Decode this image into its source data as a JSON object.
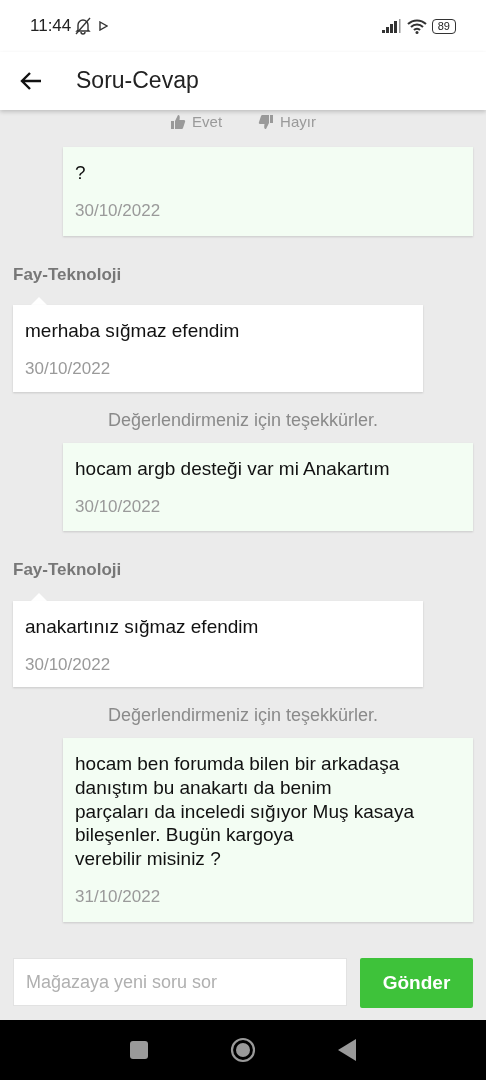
{
  "status_bar": {
    "time": "11:44",
    "battery": "89"
  },
  "app_bar": {
    "title": "Soru-Cevap"
  },
  "thread": [
    {
      "kind": "rating",
      "yes": "Evet",
      "no": "Hayır"
    },
    {
      "kind": "question",
      "text": "?",
      "date": "30/10/2022"
    },
    {
      "kind": "answer",
      "sender": "Fay-Teknoloji",
      "text": "merhaba sığmaz efendim",
      "date": "30/10/2022"
    },
    {
      "kind": "note",
      "text": "Değerlendirmeniz için teşekkürler."
    },
    {
      "kind": "question",
      "text": "hocam argb desteği var mi Anakartım",
      "date": "30/10/2022"
    },
    {
      "kind": "answer",
      "sender": "Fay-Teknoloji",
      "text": "anakartınız sığmaz efendim",
      "date": "30/10/2022"
    },
    {
      "kind": "note",
      "text": "Değerlendirmeniz için teşekkürler."
    },
    {
      "kind": "question",
      "text": "hocam ben forumda bilen bir arkadaşa\ndanıştım bu anakartı da benim\nparçaları da inceledi sığıyor Muş kasaya\nbileşenler. Bugün kargoya\nverebilir misiniz ?",
      "date": "31/10/2022"
    }
  ],
  "composer": {
    "placeholder": "Mağazaya yeni soru sor",
    "button": "Gönder"
  }
}
